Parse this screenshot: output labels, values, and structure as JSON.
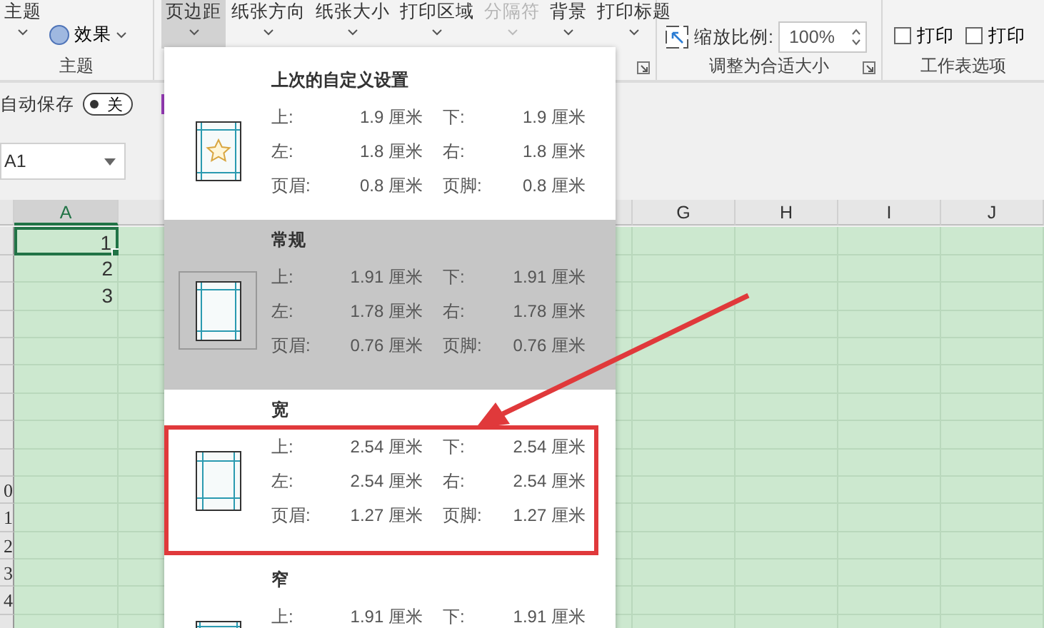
{
  "ribbon": {
    "theme_group": {
      "theme_button": "主题",
      "effects_button": "效果",
      "label": "主题"
    },
    "page_setup_buttons": [
      {
        "label": "页边距",
        "selected": true,
        "disabled": false
      },
      {
        "label": "纸张方向",
        "selected": false,
        "disabled": false
      },
      {
        "label": "纸张大小",
        "selected": false,
        "disabled": false
      },
      {
        "label": "打印区域",
        "selected": false,
        "disabled": false
      },
      {
        "label": "分隔符",
        "selected": false,
        "disabled": true
      },
      {
        "label": "背景",
        "selected": false,
        "disabled": false
      },
      {
        "label": "打印标题",
        "selected": false,
        "disabled": false
      }
    ],
    "scale_group": {
      "scale_label": "缩放比例:",
      "scale_value": "100%",
      "label": "调整为合适大小"
    },
    "sheet_options": {
      "checkboxes": [
        {
          "label": "打印",
          "checked": false
        },
        {
          "label": "打印",
          "checked": false
        }
      ],
      "label": "工作表选项"
    }
  },
  "quick_access": {
    "autosave_label": "自动保存",
    "autosave_toggle": {
      "label": "关",
      "on": false
    }
  },
  "name_box": {
    "value": "A1"
  },
  "sheet": {
    "columns": [
      "A",
      "G",
      "H",
      "I",
      "J"
    ],
    "cells": [
      "1",
      "2",
      "3"
    ],
    "row_numbers": [
      "0",
      "1",
      "2",
      "3",
      "4"
    ]
  },
  "margins_menu": {
    "items": [
      {
        "kind": "custom",
        "title": "上次的自定义设置",
        "selected": false,
        "rows": [
          {
            "left_label": "上:",
            "left_value": "1.9 厘米",
            "right_label": "下:",
            "right_value": "1.9 厘米"
          },
          {
            "left_label": "左:",
            "left_value": "1.8 厘米",
            "right_label": "右:",
            "right_value": "1.8 厘米"
          },
          {
            "left_label": "页眉:",
            "left_value": "0.8 厘米",
            "right_label": "页脚:",
            "right_value": "0.8 厘米"
          }
        ]
      },
      {
        "kind": "normal",
        "title": "常规",
        "selected": true,
        "rows": [
          {
            "left_label": "上:",
            "left_value": "1.91 厘米",
            "right_label": "下:",
            "right_value": "1.91 厘米"
          },
          {
            "left_label": "左:",
            "left_value": "1.78 厘米",
            "right_label": "右:",
            "right_value": "1.78 厘米"
          },
          {
            "left_label": "页眉:",
            "left_value": "0.76 厘米",
            "right_label": "页脚:",
            "right_value": "0.76 厘米"
          }
        ]
      },
      {
        "kind": "wide",
        "title": "宽",
        "selected": false,
        "rows": [
          {
            "left_label": "上:",
            "left_value": "2.54 厘米",
            "right_label": "下:",
            "right_value": "2.54 厘米"
          },
          {
            "left_label": "左:",
            "left_value": "2.54 厘米",
            "right_label": "右:",
            "right_value": "2.54 厘米"
          },
          {
            "left_label": "页眉:",
            "left_value": "1.27 厘米",
            "right_label": "页脚:",
            "right_value": "1.27 厘米"
          }
        ]
      },
      {
        "kind": "narrow",
        "title": "窄",
        "selected": false,
        "rows": [
          {
            "left_label": "上:",
            "left_value": "1.91 厘米",
            "right_label": "下:",
            "right_value": "1.91 厘米"
          }
        ]
      }
    ]
  }
}
